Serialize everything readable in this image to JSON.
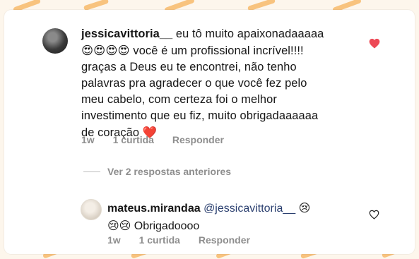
{
  "comment": {
    "username": "jessicavittoria__",
    "line1_rest": " eu tô muito apaixonadaaaaa",
    "emojis": "😍😍😍😍",
    "line2_rest": " você é um profissional incrível!!!!",
    "line3": "graças a Deus eu te encontrei, não tenho",
    "line4": "palavras pra agradecer o que você fez pelo",
    "line5": "meu cabelo, com certeza foi o melhor",
    "line6": "investimento que eu fiz, muito obrigadaaaaaa",
    "line7": "de coração",
    "end_emoji": "❤️",
    "time": "1w",
    "likes": "1 curtida",
    "reply_label": "Responder",
    "liked": true
  },
  "view_replies": "Ver 2 respostas anteriores",
  "reply": {
    "username": "mateus.mirandaa",
    "mention": "@jessicavittoria__",
    "emoji1": "😢",
    "line2_emojis": "😢😢",
    "line2_text": " Obrigadoooo",
    "time": "1w",
    "likes": "1 curtida",
    "reply_label": "Responder",
    "liked": false
  },
  "colors": {
    "heart_red": "#ed4956",
    "meta_gray": "#8e8e8e",
    "background_stroke": "#f6b15a"
  }
}
